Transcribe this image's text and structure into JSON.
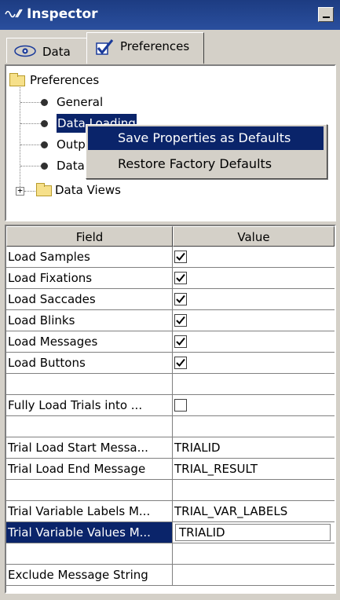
{
  "window": {
    "title": "Inspector",
    "title_icon": "inspector-icon"
  },
  "tabs": [
    {
      "label": "Data",
      "icon": "eye-icon",
      "active": false
    },
    {
      "label": "Preferences",
      "icon": "checkmark-icon",
      "active": true
    }
  ],
  "tree": {
    "root": "Preferences",
    "items": [
      {
        "label": "General"
      },
      {
        "label": "Data Loading",
        "selected": true
      },
      {
        "label": "Output"
      },
      {
        "label": "Data"
      }
    ],
    "folder_node": "Data Views"
  },
  "context_menu": {
    "items": [
      {
        "label": "Save Properties as Defaults",
        "highlighted": true
      },
      {
        "label": "Restore Factory Defaults",
        "highlighted": false
      }
    ]
  },
  "table": {
    "columns": [
      "Field",
      "Value"
    ],
    "rows": [
      {
        "field": "Load Samples",
        "checkbox": true,
        "checked": true
      },
      {
        "field": "Load Fixations",
        "checkbox": true,
        "checked": true
      },
      {
        "field": "Load Saccades",
        "checkbox": true,
        "checked": true
      },
      {
        "field": "Load Blinks",
        "checkbox": true,
        "checked": true
      },
      {
        "field": "Load Messages",
        "checkbox": true,
        "checked": true
      },
      {
        "field": "Load Buttons",
        "checkbox": true,
        "checked": true
      },
      {
        "field": "",
        "value": ""
      },
      {
        "field": "Fully Load Trials into ...",
        "checkbox": true,
        "checked": false
      },
      {
        "field": "",
        "value": ""
      },
      {
        "field": "Trial Load Start Messa...",
        "value": "TRIALID"
      },
      {
        "field": "Trial Load End Message",
        "value": "TRIAL_RESULT"
      },
      {
        "field": "",
        "value": ""
      },
      {
        "field": "Trial Variable Labels M...",
        "value": "TRIAL_VAR_LABELS"
      },
      {
        "field": "Trial Variable Values M...",
        "value": "TRIALID",
        "selected": true,
        "editing": true
      },
      {
        "field": "",
        "value": ""
      },
      {
        "field": "Exclude Message String",
        "value": ""
      }
    ]
  }
}
